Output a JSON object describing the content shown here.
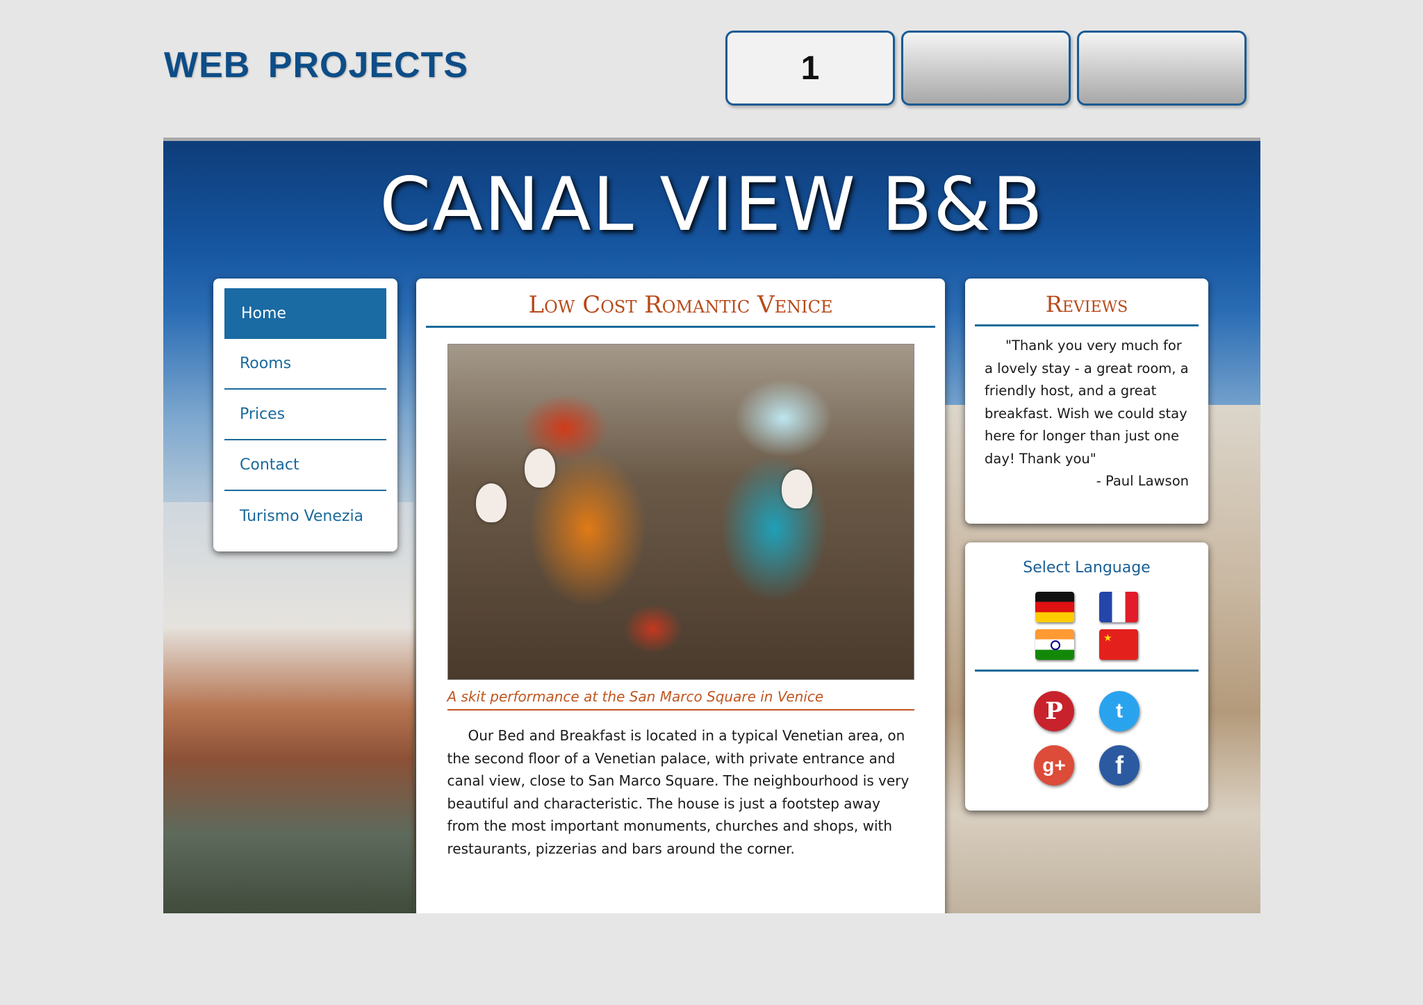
{
  "header": {
    "title": "WEB  PROJECTS"
  },
  "tabs": [
    {
      "label": "1",
      "active": true
    },
    {
      "label": "",
      "active": false
    },
    {
      "label": "",
      "active": false
    }
  ],
  "site": {
    "title": "CANAL VIEW B&B",
    "nav": [
      "Home",
      "Rooms",
      "Prices",
      "Contact",
      "Turismo Venezia"
    ],
    "main": {
      "heading": "Low Cost Romantic Venice",
      "caption": "A skit performance at the San Marco Square in Venice",
      "body": "Our Bed and Breakfast is located in a typical Venetian area, on the second floor of a Venetian palace, with private entrance and canal view, close to San Marco Square. The neighbourhood is very beautiful and characteristic. The house is just a footstep away from the most important monuments, churches and shops, with restaurants, pizzerias and bars around the corner."
    },
    "reviews": {
      "heading": "Reviews",
      "quote": "\"Thank you very much for a lovely stay - a great room, a friendly host, and a great breakfast. Wish we could stay here for longer than just one day! Thank you\"",
      "author": "- Paul Lawson"
    },
    "language": {
      "title": "Select Language",
      "flags": [
        "german-flag-icon",
        "french-flag-icon",
        "indian-flag-icon",
        "chinese-flag-icon"
      ],
      "social": [
        {
          "icon": "pinterest-icon",
          "glyph": "P"
        },
        {
          "icon": "twitter-icon",
          "glyph": "t"
        },
        {
          "icon": "google-plus-icon",
          "glyph": "g+"
        },
        {
          "icon": "facebook-icon",
          "glyph": "f"
        }
      ]
    }
  },
  "colors": {
    "brand_blue": "#1a6aa3",
    "heading_orange": "#b84a1a",
    "title_blue": "#0d4d87"
  }
}
